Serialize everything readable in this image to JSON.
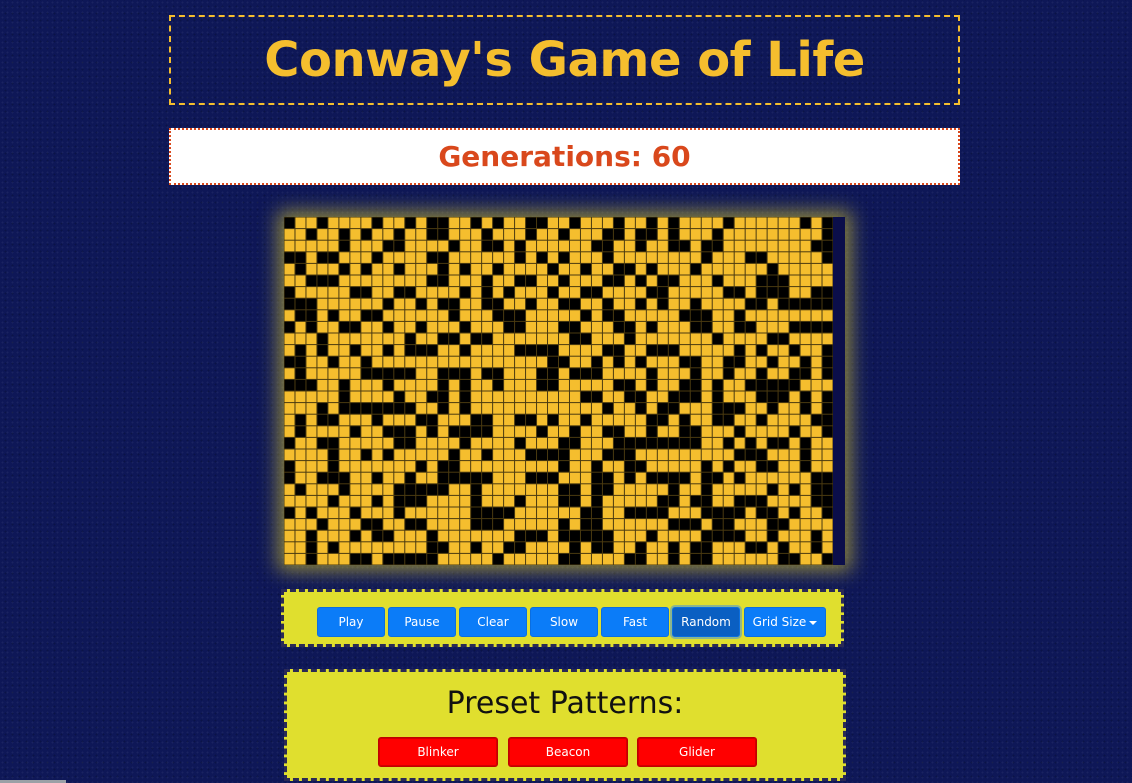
{
  "title": "Conway's Game of Life",
  "generations": {
    "text": "Generations: 60",
    "count": 60
  },
  "controls": {
    "buttons": [
      {
        "id": "play",
        "label": "Play"
      },
      {
        "id": "pause",
        "label": "Pause"
      },
      {
        "id": "clear",
        "label": "Clear"
      },
      {
        "id": "slow",
        "label": "Slow"
      },
      {
        "id": "fast",
        "label": "Fast"
      },
      {
        "id": "random",
        "label": "Random",
        "active": true
      }
    ],
    "grid_size": {
      "label": "Grid Size",
      "icon": "caret-down-icon"
    }
  },
  "presets": {
    "heading": "Preset Patterns:",
    "buttons": [
      {
        "id": "blinker",
        "label": "Blinker"
      },
      {
        "id": "beacon",
        "label": "Beacon"
      },
      {
        "id": "glider",
        "label": "Glider"
      }
    ]
  },
  "board": {
    "rows": 30,
    "cols": 50,
    "alive_color": "#000000",
    "dead_color": "#f5be2e",
    "gridline_color": "#4a3a10",
    "cells": [
      "10010000100101100101001100100010010100001000000101",
      "00100101001001100010001001000110110100010000000001",
      "00000100011000010011010000001100100110110000000011",
      "11011000100001100000010101000100000000100011000001",
      "01000101001000101001000010010011010001000000100000",
      "00111000000001100010011001000110101100010001110000",
      "10000011001100001010100010011000011000001101110011",
      "11100000010010110011001001100100101001000011011111",
      "01101001100000010001110000010110000011100100000000",
      "10100110010010001000110001100011010001100110001111",
      "00010000000100110110000000110001000000010000110000",
      "01010010010111001000011110000110011100000101001001",
      "11001001000000000000000011001010100011001100100101",
      "01000001111100111011000110111000010001001001001101",
      "11100100010000101001000110000011010011010011111000",
      "00000100001001101000000000011001100111010001110101",
      "00010111111100101000000000000100101100011100100101",
      "01011000100011000110011010010000011010011001000011",
      "01000010011101011110000100100110010011000100001001",
      "10011000001100001000010001100011111111001010110100",
      "00001001010000010010001111000111000000000111000100",
      "10001000000010110000000001001001100000101001100100",
      "10011100100100111110001110001101011110110100000011",
      "01000100001111100100000001101100000100100000101011",
      "00001000101110000100010001101000001101100111000011",
      "10100010001000000111100000011001111000111101101001",
      "00010001100110000111000001011000000111011000110000",
      "00100010110001000000011101111100010000111100100010",
      "00101000000001100100110000101100100101100011010010",
      "00100011011111000001000001100001100101100000011001"
    ]
  }
}
